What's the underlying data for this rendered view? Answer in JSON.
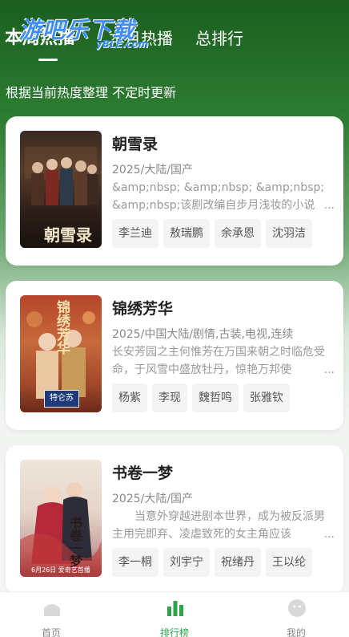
{
  "header": {
    "tabs": [
      {
        "label": "本周热播",
        "active": true
      },
      {
        "label": "本月热播",
        "active": false
      },
      {
        "label": "总排行",
        "active": false
      }
    ],
    "watermark": "游吧乐下载",
    "watermark_sub": "yBLE.com",
    "subtitle": "根据当前热度整理 不定时更新"
  },
  "cards": [
    {
      "title": "朝雪录",
      "meta": "2025/大陆/国产",
      "description": "&amp;nbsp; &amp;nbsp; &amp;nbsp; &amp;nbsp;该剧改编自步月浅妆的小说",
      "poster_text": "朝雪录",
      "tags": [
        "李兰迪",
        "敖瑞鹏",
        "余承恩",
        "沈羽洁"
      ]
    },
    {
      "title": "锦绣芳华",
      "meta": "2025/中国大陆/剧情,古装,电视,连续",
      "description": "长安芳园之主何惟芳在万国来朝之时临危受命，于风雪中盛放牡丹，惊艳万邦使",
      "poster_text": "锦绣芳华",
      "poster_badge": "特仑苏",
      "tags": [
        "杨紫",
        "李现",
        "魏哲鸣",
        "张雅钦"
      ]
    },
    {
      "title": "书卷一梦",
      "meta": "2025/大陆/国产",
      "description": "当意外穿越进剧本世界，成为被反派男主用完即弃、凌虐致死的女主角应该",
      "poster_text": "书卷一梦",
      "poster_caption": "6月26日 爱奇艺首播",
      "tags": [
        "李一桐",
        "刘宇宁",
        "祝绪丹",
        "王以纶"
      ]
    }
  ],
  "ellipsis": "...",
  "bottom_nav": [
    {
      "label": "首页",
      "icon": "home-icon",
      "active": false
    },
    {
      "label": "排行榜",
      "icon": "ranking-icon",
      "active": true
    },
    {
      "label": "我的",
      "icon": "profile-icon",
      "active": false
    }
  ],
  "colors": {
    "header_green": "#1b5e20",
    "accent_green": "#2fa34b",
    "watermark_blue": "#3f8ef7"
  }
}
